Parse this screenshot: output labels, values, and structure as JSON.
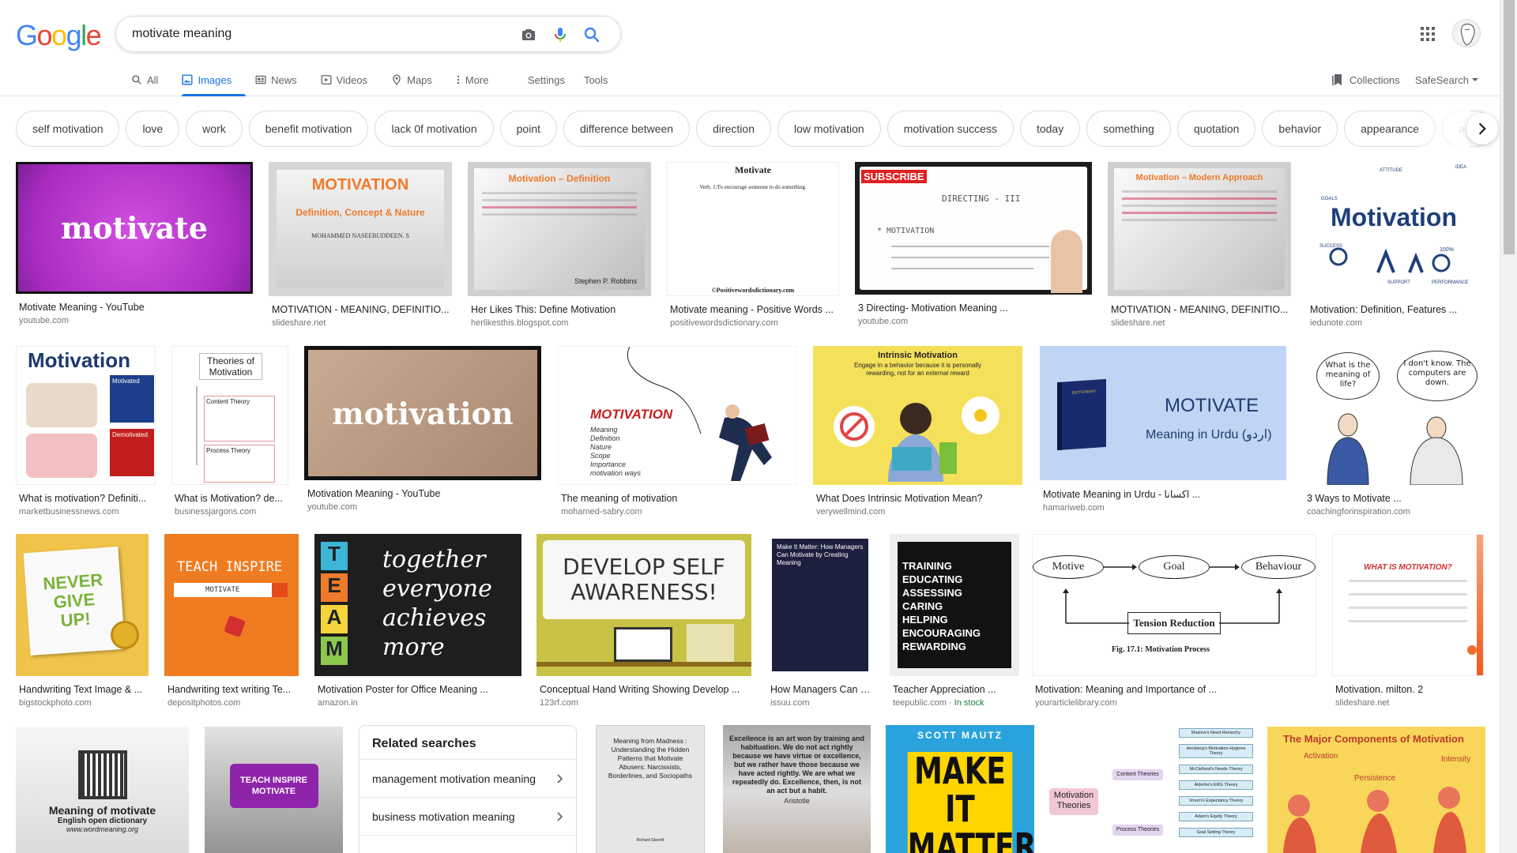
{
  "search": {
    "query": "motivate meaning"
  },
  "logo": {
    "text": "Google"
  },
  "tabs": [
    {
      "label": "All",
      "icon": "search-icon"
    },
    {
      "label": "Images",
      "icon": "image-icon",
      "active": true
    },
    {
      "label": "News",
      "icon": "news-icon"
    },
    {
      "label": "Videos",
      "icon": "video-icon"
    },
    {
      "label": "Maps",
      "icon": "map-pin-icon"
    },
    {
      "label": "More",
      "icon": "more-vert-icon"
    }
  ],
  "settings_label": "Settings",
  "tools_label": "Tools",
  "collections_label": "Collections",
  "safesearch_label": "SafeSearch",
  "chips": [
    "self motivation",
    "love",
    "work",
    "benefit motivation",
    "lack 0f motivation",
    "point",
    "difference between",
    "direction",
    "low motivation",
    "motivation success",
    "today",
    "something",
    "quotation",
    "behavior",
    "appearance",
    "adv"
  ],
  "results": {
    "r1": {
      "caption": "Motivate Meaning - YouTube",
      "source": "youtube.com",
      "thumb_text": "motivate"
    },
    "r2": {
      "caption": "MOTIVATION - MEANING, DEFINITIO...",
      "source": "slideshare.net",
      "thumb_title": "MOTIVATION",
      "thumb_sub": "Definition, Concept & Nature",
      "thumb_author": "MOHAMMED NASEERUDDEEN. S"
    },
    "r3": {
      "caption": "Her Likes This: Define Motivation",
      "source": "herlikesthis.blogspot.com",
      "thumb_title": "Motivation – Definition",
      "thumb_author": "Stephen P. Robbins"
    },
    "r4": {
      "caption": "Motivate meaning - Positive Words ...",
      "source": "positivewordsdictionary.com",
      "thumb_title": "Motivate",
      "thumb_sub": "Verb. 1:To encourage someone to do something.",
      "thumb_footer": "©Positivewordsdictionary.com"
    },
    "r5": {
      "caption": "3 Directing- Motivation Meaning ...",
      "source": "youtube.com",
      "thumb_title": "SUBSCRIBE",
      "thumb_sub": "DIRECTING - III",
      "thumb_note": "* MOTIVATION"
    },
    "r6": {
      "caption": "MOTIVATION - MEANING, DEFINITIO...",
      "source": "slideshare.net",
      "thumb_title": "Motivation – Modern Approach"
    },
    "r7": {
      "caption": "Motivation: Definition, Features ...",
      "source": "iedunote.com",
      "thumb_title": "Motivation",
      "thumb_labels": [
        "GOALS",
        "ATTITUDE",
        "IDEA",
        "SUCCESS",
        "SUPPORT",
        "PERFORMANCE",
        "100%"
      ]
    },
    "r8": {
      "caption": "What is motivation? Definiti...",
      "source": "marketbusinessnews.com",
      "thumb_title": "Motivation",
      "thumb_a": "Motivated",
      "thumb_b": "Demotivated"
    },
    "r9": {
      "caption": "What is Motivation? de...",
      "source": "businessjargons.com",
      "thumb_title": "Theories of Motivation",
      "thumb_a": "Content Theory",
      "thumb_b": "Process Theory"
    },
    "r10": {
      "caption": "Motivation Meaning - YouTube",
      "source": "youtube.com",
      "thumb_text": "motivation"
    },
    "r11": {
      "caption": "The meaning of motivation",
      "source": "mohamed-sabry.com",
      "thumb_title": "MOTIVATION",
      "thumb_list": [
        "Meaning",
        "Definition",
        "Nature",
        "Scope",
        "Importance",
        "motivation ways"
      ]
    },
    "r12": {
      "caption": "What Does Intrinsic Motivation Mean?",
      "source": "verywellmind.com",
      "thumb_title": "Intrinsic Motivation",
      "thumb_sub": "Engage in a behavior because it is personally rewarding, not for an external reward"
    },
    "r13": {
      "caption": "Motivate Meaning in Urdu - اکسانا ...",
      "source": "hamariweb.com",
      "thumb_title": "MOTIVATE",
      "thumb_sub": "Meaning in Urdu (اردو)",
      "thumb_book": "DICTIONARY"
    },
    "r14": {
      "caption": "3 Ways to Motivate ...",
      "source": "coachingforinspiration.com",
      "thumb_a": "What is the meaning of life?",
      "thumb_b": "I don't know. The computers are down."
    },
    "r15": {
      "caption": "Handwriting Text Image & ...",
      "source": "bigstockphoto.com",
      "thumb_text": "NEVER GIVE UP!"
    },
    "r16": {
      "caption": "Handwriting text writing Te...",
      "source": "depositphotos.com",
      "thumb_title": "TEACH INSPIRE",
      "thumb_sub": "MOTIVATE"
    },
    "r17": {
      "caption": "Motivation Poster for Office Meaning ...",
      "source": "amazon.in",
      "thumb_letters": [
        "T",
        "E",
        "A",
        "M"
      ],
      "thumb_words": [
        "together",
        "everyone",
        "achieves",
        "more"
      ]
    },
    "r18": {
      "caption": "Conceptual Hand Writing Showing Develop ...",
      "source": "123rf.com",
      "thumb_text": "DEVELOP SELF AWARENESS!"
    },
    "r19": {
      "caption": "How Managers Can M...",
      "source": "issuu.com",
      "thumb_text": "Make It Matter: How Managers Can Motivate by Creating Meaning"
    },
    "r20": {
      "caption": "Teacher Appreciation ...",
      "source": "teepublic.com",
      "stock": "In stock",
      "thumb_list": [
        "TRAINING",
        "EDUCATING",
        "ASSESSING",
        "CARING",
        "HELPING",
        "ENCOURAGING",
        "REWARDING"
      ]
    },
    "r21": {
      "caption": "Motivation: Meaning and Importance of ...",
      "source": "yourarticlelibrary.com",
      "thumb_a": "Motive",
      "thumb_b": "Goal",
      "thumb_c": "Behaviour",
      "thumb_d": "Tension Reduction",
      "thumb_fig": "Fig. 17.1: Motivation Process"
    },
    "r22": {
      "caption": "Motivation. milton. 2",
      "source": "slideshare.net",
      "thumb_title": "WHAT IS MOTIVATION?"
    },
    "r23": {
      "thumb_title": "Meaning of motivate",
      "thumb_sub": "English open dictionary",
      "thumb_url": "www.wordmeaning.org"
    },
    "r24": {
      "thumb_text": "TEACH INSPIRE MOTIVATE"
    },
    "r25": {
      "thumb_text": "Meaning from Madness : Understanding the Hidden Patterns that Motivate Abusers: Narcissists, Borderlines, and Sociopaths",
      "thumb_author": "Richard Skerritt"
    },
    "r26": {
      "thumb_text": "Excellence is an art won by training and habituation. We do not act rightly because we have virtue or excellence, but we rather have those because we have acted rightly. We are what we repeatedly do. Excellence, then, is not an act but a habit.",
      "thumb_author": "Aristotle"
    },
    "r27": {
      "thumb_author": "SCOTT MAUTZ",
      "thumb_text": "MAKE IT MATTER"
    },
    "r28": {
      "thumb_title": "Motivation Theories",
      "thumb_a": "Content Theories",
      "thumb_b": "Process Theories",
      "thumb_list": [
        "Maslow's Need Hierarchy",
        "Herzberg's Motivation-Hygiene Theory",
        "McClelland's Needs Theory",
        "Alderfer's ERG Theory",
        "Vroom's Expectancy Theory",
        "Adam's Equity Theory",
        "Goal Setting Theory"
      ]
    },
    "r29": {
      "thumb_title": "The Major Components of Motivation",
      "thumb_a": "Activation",
      "thumb_b": "Persistence",
      "thumb_c": "Intensity"
    }
  },
  "related": {
    "title": "Related searches",
    "items": [
      "management motivation meaning",
      "business motivation meaning"
    ]
  },
  "colors": {
    "accent": "#1a73e8",
    "border": "#dadce0",
    "muted": "#70757a"
  }
}
